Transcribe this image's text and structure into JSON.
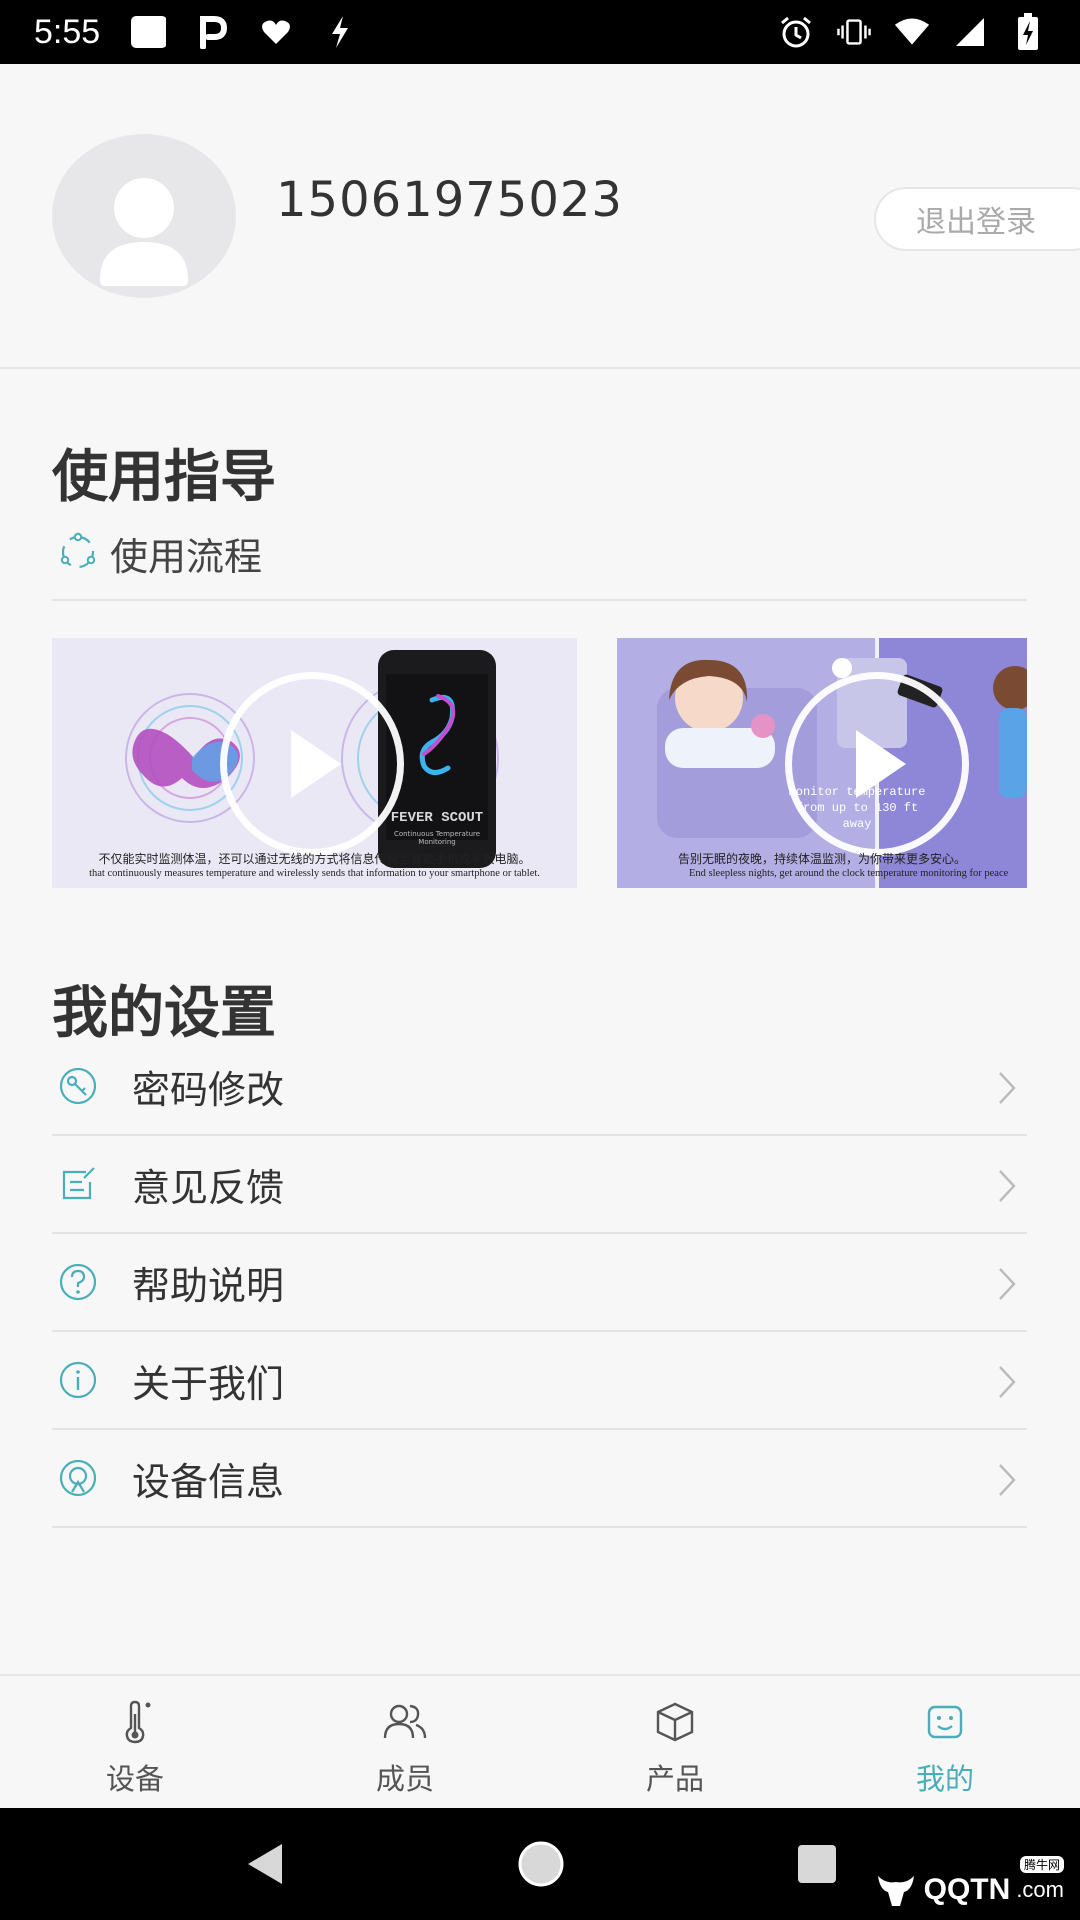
{
  "status_bar": {
    "time": "5:55",
    "left_icons": [
      "notification-square-icon",
      "p-app-icon",
      "heart-icon",
      "bolt-icon"
    ],
    "right_icons": [
      "alarm-icon",
      "vibrate-icon",
      "wifi-icon",
      "signal-icon",
      "battery-charging-icon"
    ]
  },
  "profile": {
    "phone_number": "15061975023",
    "logout_label": "退出登录"
  },
  "guide": {
    "heading": "使用指导",
    "sub_label": "使用流程",
    "videos": [
      {
        "caption_cn": "不仅能实时监测体温，还可以通过无线的方式将信息传输至智能手机或平板电脑。",
        "caption_en": "that continuously measures temperature and wirelessly sends that information to your smartphone or tablet.",
        "product_brand": "FEVER SCOUT",
        "product_sub": "Continuous Temperature Monitoring"
      },
      {
        "caption_cn": "告别无眠的夜晚，持续体温监测，为你带来更多安心。",
        "caption_en": "End sleepless nights, get around the clock temperature monitoring for peace",
        "overlay_text": "Monitor temperature from up to 130 ft away"
      }
    ]
  },
  "settings": {
    "heading": "我的设置",
    "items": [
      {
        "label": "密码修改",
        "icon": "key-icon"
      },
      {
        "label": "意见反馈",
        "icon": "feedback-edit-icon"
      },
      {
        "label": "帮助说明",
        "icon": "help-question-icon"
      },
      {
        "label": "关于我们",
        "icon": "info-icon"
      },
      {
        "label": "设备信息",
        "icon": "device-info-icon"
      }
    ]
  },
  "tabs": [
    {
      "label": "设备",
      "icon": "thermometer-icon",
      "active": false
    },
    {
      "label": "成员",
      "icon": "members-icon",
      "active": false
    },
    {
      "label": "产品",
      "icon": "product-box-icon",
      "active": false
    },
    {
      "label": "我的",
      "icon": "smiley-face-icon",
      "active": true
    }
  ],
  "colors": {
    "accent": "#4aaeb8",
    "background": "#f7f7f8",
    "text": "#333333"
  },
  "watermark": {
    "brand": "QQTN",
    "suffix": ".com",
    "badge": "腾牛网"
  }
}
